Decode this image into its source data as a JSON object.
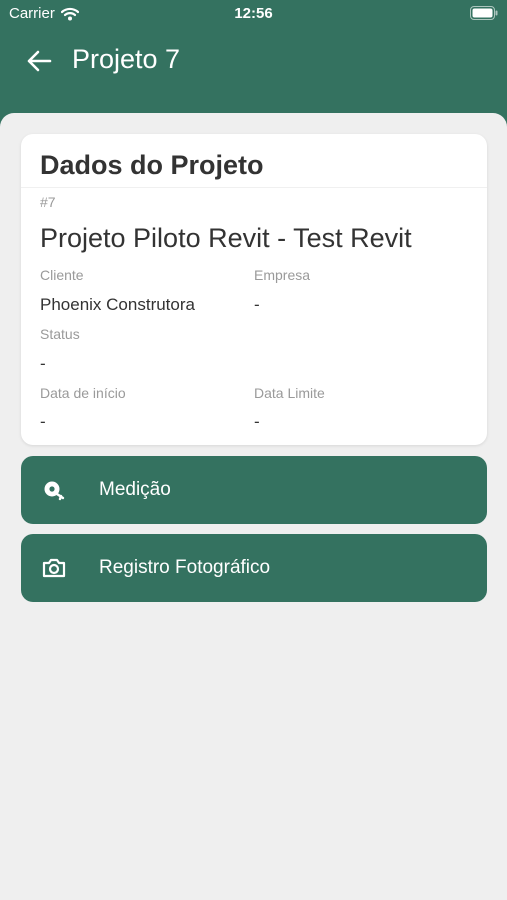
{
  "status_bar": {
    "carrier": "Carrier",
    "time": "12:56",
    "icons": [
      "wifi-icon",
      "battery-icon"
    ]
  },
  "header": {
    "title": "Projeto 7",
    "back_icon": "arrow-left-icon",
    "background_color": "#347260"
  },
  "project_card": {
    "heading": "Dados do Projeto",
    "id": "#7",
    "name": "Projeto Piloto Revit - Test Revit",
    "fields": {
      "cliente": {
        "label": "Cliente",
        "value": "Phoenix Construtora"
      },
      "empresa": {
        "label": "Empresa",
        "value": "-"
      },
      "status": {
        "label": "Status",
        "value": "-"
      },
      "data_inicio": {
        "label": "Data de início",
        "value": "-"
      },
      "data_limite": {
        "label": "Data Limite",
        "value": "-"
      }
    }
  },
  "actions": [
    {
      "label": "Medição",
      "icon": "measure-search-icon"
    },
    {
      "label": "Registro Fotográfico",
      "icon": "camera-icon"
    }
  ],
  "colors": {
    "accent": "#347260",
    "background": "#efefef",
    "text_primary": "#333333",
    "text_secondary": "#9a9a9a"
  }
}
